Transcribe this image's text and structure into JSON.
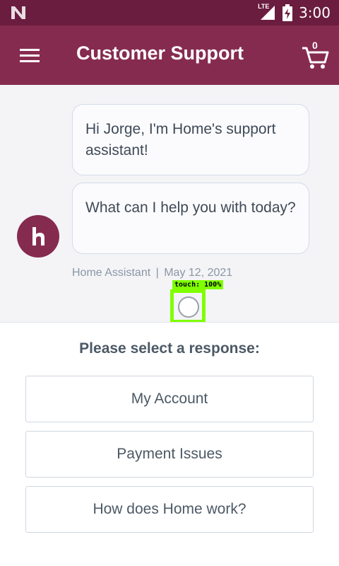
{
  "status_bar": {
    "network": "LTE",
    "time": "3:00"
  },
  "header": {
    "title": "Customer Support",
    "cart_count": "0"
  },
  "chat": {
    "messages": [
      "Hi Jorge, I'm Home's support assistant!",
      "What can I help you with today?"
    ],
    "sender": "Home Assistant",
    "separator": "|",
    "date": "May 12, 2021"
  },
  "touch_overlay": {
    "label": "touch: 100%"
  },
  "responses": {
    "prompt": "Please select a response:",
    "options": [
      "My Account",
      "Payment Issues",
      "How does Home work?"
    ]
  },
  "colors": {
    "status_bar": "#6a1d3f",
    "app_bar": "#862b50",
    "chat_background": "#f4f4f7",
    "touch_indicator": "#7fff00"
  },
  "icons": {
    "status_left": "n-notification-icon",
    "signal": "signal-icon",
    "battery": "battery-charging-icon",
    "menu": "hamburger-menu-icon",
    "cart": "shopping-cart-icon",
    "avatar": "home-logo-icon"
  }
}
